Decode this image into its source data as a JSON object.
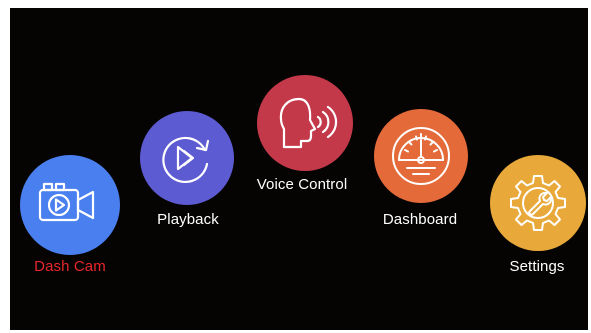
{
  "menu": {
    "items": [
      {
        "label": "Dash Cam",
        "icon": "camera-play-icon",
        "color": "#4a7ff0",
        "label_color": "#e8262a",
        "selected": true
      },
      {
        "label": "Playback",
        "icon": "replay-icon",
        "color": "#5d5bd2",
        "label_color": "#ffffff",
        "selected": false
      },
      {
        "label": "Voice Control",
        "icon": "voice-head-icon",
        "color": "#c4394a",
        "label_color": "#ffffff",
        "selected": false
      },
      {
        "label": "Dashboard",
        "icon": "gauge-icon",
        "color": "#e46a3a",
        "label_color": "#ffffff",
        "selected": false
      },
      {
        "label": "Settings",
        "icon": "gear-wrench-icon",
        "color": "#e8a93a",
        "label_color": "#ffffff",
        "selected": false
      }
    ]
  }
}
